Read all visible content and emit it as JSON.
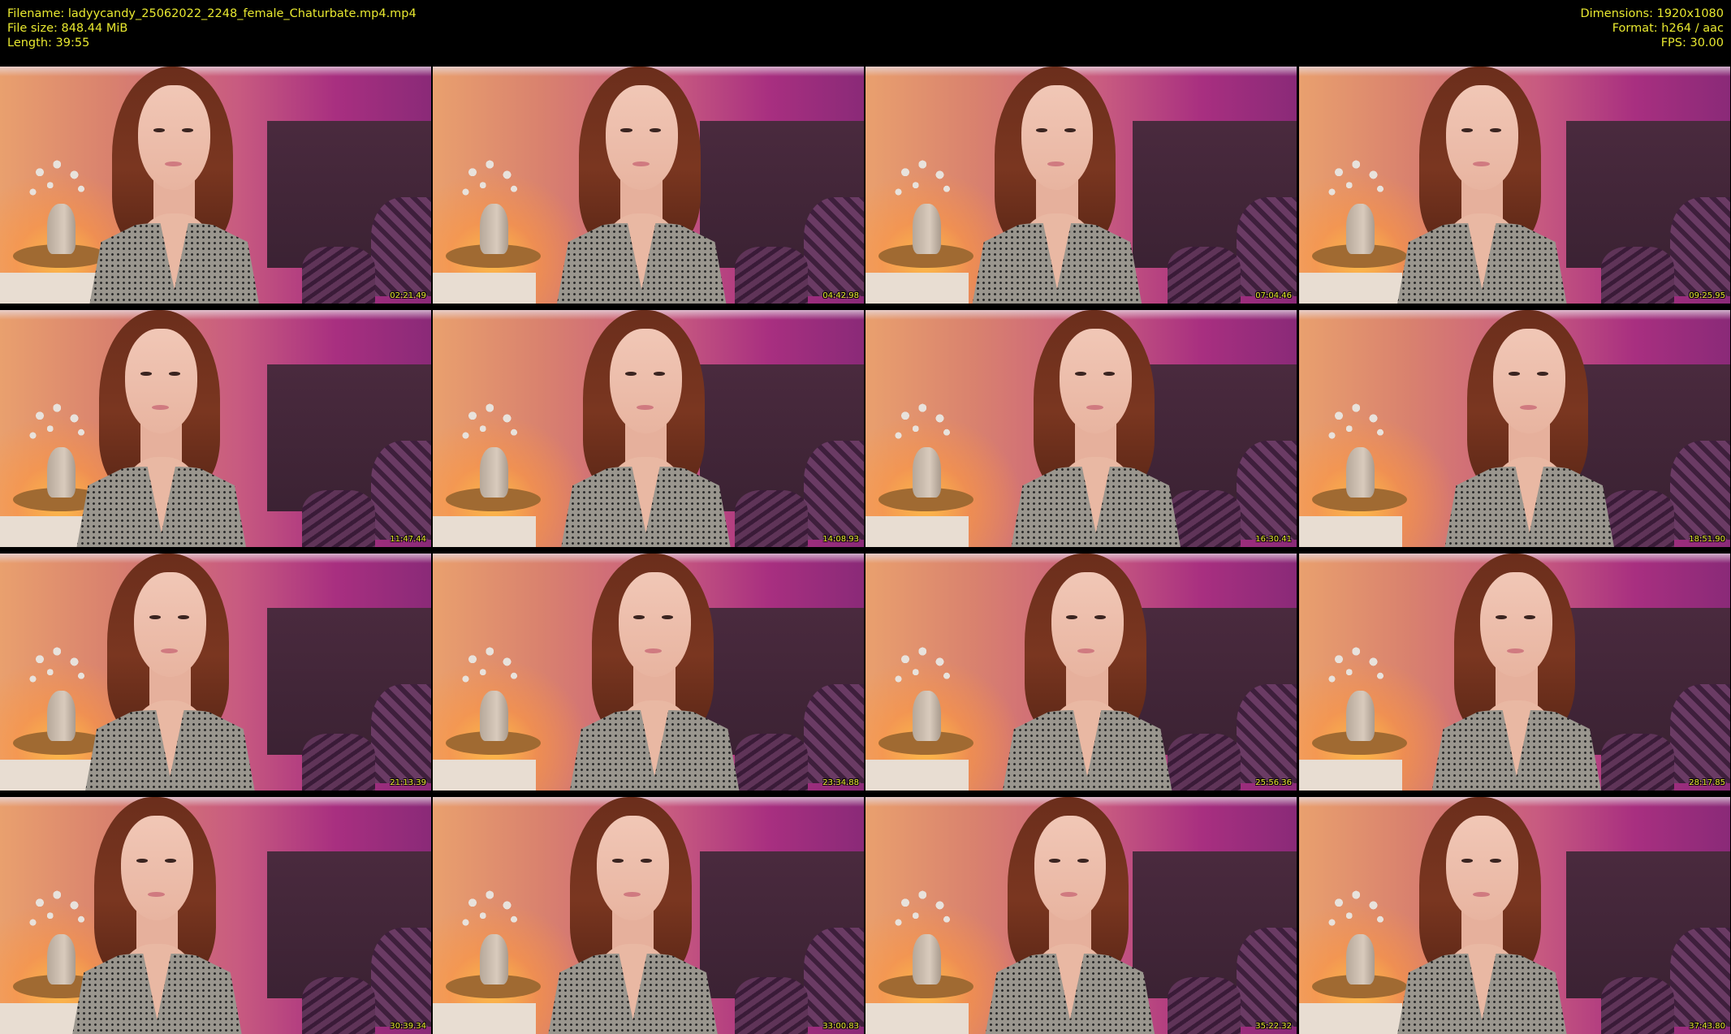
{
  "info": {
    "filename_line": "Filename: ladyycandy_25062022_2248_female_Chaturbate.mp4.mp4",
    "filesize_line": "File size: 848.44 MiB",
    "length_line": "Length: 39:55",
    "dimensions_line": "Dimensions: 1920x1080",
    "format_line": "Format: h264 / aac",
    "fps_line": "FPS: 30.00"
  },
  "colors": {
    "text_accent": "#e8e830",
    "background": "#000000"
  },
  "thumbnails": [
    {
      "timestamp": "02:21.49"
    },
    {
      "timestamp": "04:42.98"
    },
    {
      "timestamp": "07:04.46"
    },
    {
      "timestamp": "09:25.95"
    },
    {
      "timestamp": "11:47.44"
    },
    {
      "timestamp": "14:08.93"
    },
    {
      "timestamp": "16:30.41"
    },
    {
      "timestamp": "18:51.90"
    },
    {
      "timestamp": "21:13.39"
    },
    {
      "timestamp": "23:34.88"
    },
    {
      "timestamp": "25:56.36"
    },
    {
      "timestamp": "28:17.85"
    },
    {
      "timestamp": "30:39.34"
    },
    {
      "timestamp": "33:00.83"
    },
    {
      "timestamp": "35:22.32"
    },
    {
      "timestamp": "37:43.80"
    }
  ]
}
